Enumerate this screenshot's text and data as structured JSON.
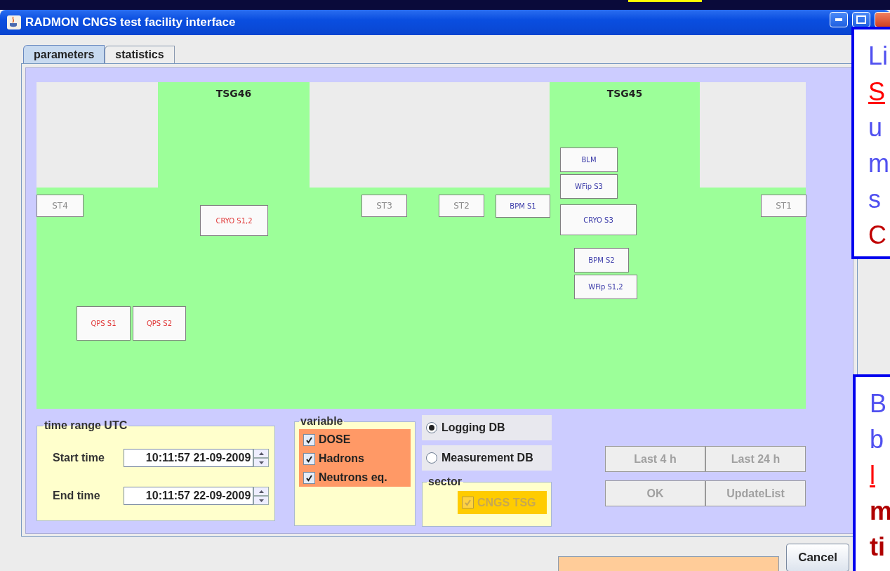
{
  "window": {
    "title": "RADMON CNGS test facility interface"
  },
  "tabs": [
    {
      "label": "parameters",
      "selected": true
    },
    {
      "label": "statistics",
      "selected": false
    }
  ],
  "diagram": {
    "zones": [
      {
        "kind": "empty"
      },
      {
        "kind": "area",
        "label": "TSG46"
      },
      {
        "kind": "empty"
      },
      {
        "kind": "area",
        "label": "TSG45"
      },
      {
        "kind": "empty"
      }
    ],
    "devices": [
      {
        "label": "ST4",
        "kind": "station",
        "color": "#8a8a8a"
      },
      {
        "label": "CRYO S1,2",
        "kind": "sensor",
        "color": "#e03a3a"
      },
      {
        "label": "ST3",
        "kind": "station",
        "color": "#8a8a8a"
      },
      {
        "label": "ST2",
        "kind": "station",
        "color": "#8a8a8a"
      },
      {
        "label": "BPM S1",
        "kind": "sensor",
        "color": "#3a3aa8"
      },
      {
        "label": "BLM",
        "kind": "sensor",
        "color": "#3a3aa8"
      },
      {
        "label": "WFip S3",
        "kind": "sensor",
        "color": "#3a3aa8"
      },
      {
        "label": "CRYO S3",
        "kind": "sensor",
        "color": "#3a3aa8"
      },
      {
        "label": "BPM S2",
        "kind": "sensor",
        "color": "#3a3aa8"
      },
      {
        "label": "WFip S1,2",
        "kind": "sensor",
        "color": "#3a3aa8"
      },
      {
        "label": "ST1",
        "kind": "station",
        "color": "#8a8a8a"
      },
      {
        "label": "QPS S1",
        "kind": "sensor",
        "color": "#e03a3a"
      },
      {
        "label": "QPS S2",
        "kind": "sensor",
        "color": "#e03a3a"
      }
    ]
  },
  "time_range": {
    "title": "time range UTC",
    "fields": [
      {
        "label": "Start time",
        "value": "10:11:57 21-09-2009"
      },
      {
        "label": "End time",
        "value": "10:11:57 22-09-2009"
      }
    ]
  },
  "variable": {
    "title": "variable",
    "options": [
      {
        "label": "DOSE",
        "checked": true
      },
      {
        "label": "Hadrons",
        "checked": true
      },
      {
        "label": "Neutrons eq.",
        "checked": true
      }
    ]
  },
  "sources": [
    {
      "label": "Logging DB",
      "selected": true
    },
    {
      "label": "Measurement DB",
      "selected": false
    }
  ],
  "sector": {
    "title": "sector",
    "option": {
      "label": "CNGS TSG",
      "checked": true,
      "disabled": true
    }
  },
  "buttons": [
    {
      "label": "Last 4 h",
      "disabled": true
    },
    {
      "label": "Last 24 h",
      "disabled": true
    },
    {
      "label": "OK",
      "disabled": true
    },
    {
      "label": "UpdateList",
      "disabled": true
    }
  ],
  "cancel_button": {
    "label": "Cancel"
  },
  "callouts": [
    {
      "lines": [
        {
          "text": "Li",
          "kind": "plain"
        },
        {
          "text": "S",
          "kind": "link"
        },
        {
          "text": "u",
          "kind": "plain"
        },
        {
          "text": "m",
          "kind": "plain"
        },
        {
          "text": "s",
          "kind": "plain"
        },
        {
          "text": "C",
          "kind": "emphasis"
        }
      ]
    },
    {
      "lines": [
        {
          "text": "B",
          "kind": "plain"
        },
        {
          "text": "b",
          "kind": "plain"
        },
        {
          "text": "l",
          "kind": "link"
        },
        {
          "text": "m",
          "kind": "strong"
        },
        {
          "text": "ti",
          "kind": "strong"
        }
      ]
    }
  ]
}
